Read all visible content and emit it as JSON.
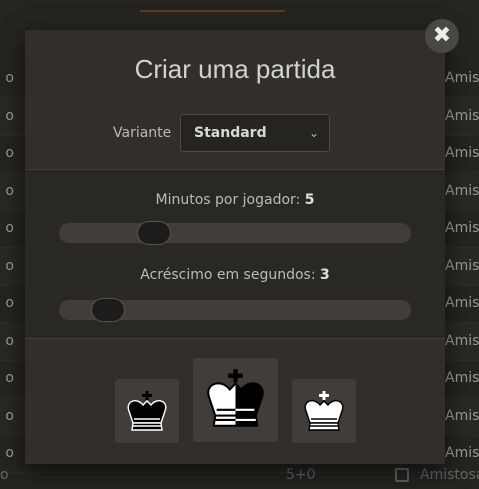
{
  "background": {
    "rows": [
      {
        "left": "o",
        "right": "Amistosa"
      },
      {
        "left": "o",
        "right": "Amistosa"
      },
      {
        "left": "o",
        "right": "Amistosa"
      },
      {
        "left": "o",
        "right": "Amistosa"
      },
      {
        "left": "o",
        "right": "Amistosa"
      },
      {
        "left": "o",
        "right": "Amistosa"
      },
      {
        "left": "o",
        "right": "Amistosa"
      },
      {
        "left": "o",
        "right": "Amistosa"
      },
      {
        "left": "o",
        "right": "Amistosa"
      },
      {
        "left": "o",
        "right": "Amistosa"
      },
      {
        "left": "o",
        "right": "Amistosa"
      }
    ],
    "bottom_row": {
      "left": "o",
      "time": "5+0",
      "mode": "Amistosa"
    }
  },
  "modal": {
    "title": "Criar uma partida",
    "close_glyph": "✖",
    "variant": {
      "label": "Variante",
      "selected": "Standard"
    },
    "minutes": {
      "label": "Minutos por jogador:",
      "value": "5",
      "slider_level": 0.27
    },
    "increment": {
      "label": "Acréscimo em segundos:",
      "value": "3",
      "slider_level": 0.14
    },
    "colors": {
      "options": [
        "black",
        "random",
        "white"
      ]
    }
  },
  "colors": {
    "modal_bg": "#312e2b",
    "page_bg": "#262421",
    "track": "#403d3a"
  }
}
